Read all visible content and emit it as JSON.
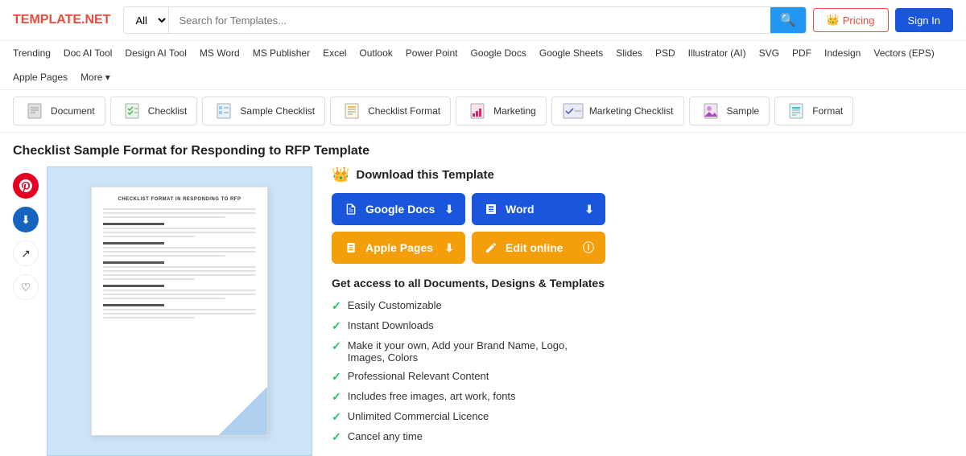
{
  "header": {
    "logo": "TEMPLATE.NET",
    "logo_prefix": "TEMPLATE.",
    "logo_suffix": "NET",
    "search_placeholder": "Search for Templates...",
    "search_category": "All",
    "pricing_label": "Pricing",
    "signin_label": "Sign In"
  },
  "nav": {
    "items": [
      "Trending",
      "Doc AI Tool",
      "Design AI Tool",
      "MS Word",
      "MS Publisher",
      "Excel",
      "Outlook",
      "Power Point",
      "Google Docs",
      "Google Sheets",
      "Slides",
      "PSD",
      "Illustrator (AI)",
      "SVG",
      "PDF",
      "Indesign",
      "Vectors (EPS)",
      "Apple Pages",
      "More"
    ]
  },
  "category_tabs": [
    {
      "label": "Document",
      "icon": "📄"
    },
    {
      "label": "Checklist",
      "icon": "✅"
    },
    {
      "label": "Sample Checklist",
      "icon": "📋"
    },
    {
      "label": "Checklist Format",
      "icon": "📝"
    },
    {
      "label": "Marketing",
      "icon": "📊"
    },
    {
      "label": "Marketing Checklist",
      "icon": "📈"
    },
    {
      "label": "Sample",
      "icon": "🖼️"
    },
    {
      "label": "Format",
      "icon": "📑"
    }
  ],
  "page": {
    "title": "Checklist Sample Format for Responding to RFP Template"
  },
  "download_section": {
    "header": "Download this Template",
    "buttons": [
      {
        "label": "Google Docs",
        "type": "google"
      },
      {
        "label": "Word",
        "type": "word"
      },
      {
        "label": "Apple Pages",
        "type": "apple"
      },
      {
        "label": "Edit online",
        "type": "edit"
      }
    ]
  },
  "features": {
    "title": "Get access to all Documents, Designs & Templates",
    "items": [
      "Easily Customizable",
      "Instant Downloads",
      "Make it your own, Add your Brand Name, Logo, Images, Colors",
      "Professional Relevant Content",
      "Includes free images, art work, fonts",
      "Unlimited Commercial Licence",
      "Cancel any time"
    ]
  },
  "template_doc": {
    "title": "CHECKLIST FORMAT IN RESPONDING TO RFP"
  },
  "social": {
    "pinterest": "♥",
    "download": "⬇",
    "share": "↗",
    "heart": "♡"
  }
}
